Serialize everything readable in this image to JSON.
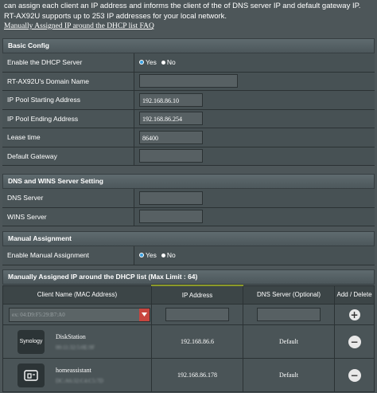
{
  "intro": {
    "text": "can assign each client an IP address and informs the client of the of DNS server IP and default gateway IP. RT-AX92U supports up to 253 IP addresses for your local network.",
    "faq_link": "Manually Assigned IP around the DHCP list FAQ"
  },
  "basic": {
    "title": "Basic Config",
    "enable_dhcp": {
      "label": "Enable the DHCP Server",
      "yes": "Yes",
      "no": "No",
      "selected": "Yes"
    },
    "domain_name": {
      "label": "RT-AX92U's Domain Name",
      "value": ""
    },
    "pool_start": {
      "label": "IP Pool Starting Address",
      "value": "192.168.86.10"
    },
    "pool_end": {
      "label": "IP Pool Ending Address",
      "value": "192.168.86.254"
    },
    "lease_time": {
      "label": "Lease time",
      "value": "86400"
    },
    "gateway": {
      "label": "Default Gateway",
      "value": ""
    }
  },
  "dns_wins": {
    "title": "DNS and WINS Server Setting",
    "dns": {
      "label": "DNS Server",
      "value": ""
    },
    "wins": {
      "label": "WINS Server",
      "value": ""
    }
  },
  "manual": {
    "title": "Manual Assignment",
    "enable": {
      "label": "Enable Manual Assignment",
      "yes": "Yes",
      "no": "No",
      "selected": "Yes"
    }
  },
  "list": {
    "title": "Manually Assigned IP around the DHCP list (Max Limit : 64)",
    "columns": [
      "Client Name (MAC Address)",
      "IP Address",
      "DNS Server (Optional)",
      "Add / Delete"
    ],
    "mac_placeholder": "ex: 04:D9:F5:29:B7:A0",
    "rows": [
      {
        "name": "DiskStation",
        "mac": "00:11:32:5:0E:9F",
        "ip": "192.168.86.6",
        "dns": "Default",
        "icon": "synology-icon",
        "icon_text": "Synology"
      },
      {
        "name": "homeassistant",
        "mac": "DC:A6:32:C4:C5:7D",
        "ip": "192.168.86.178",
        "dns": "Default",
        "icon": "device-icon",
        "icon_text": ""
      }
    ]
  },
  "colors": {
    "accent_red": "#c8453f",
    "selected_radio": "#3aa0e0"
  }
}
